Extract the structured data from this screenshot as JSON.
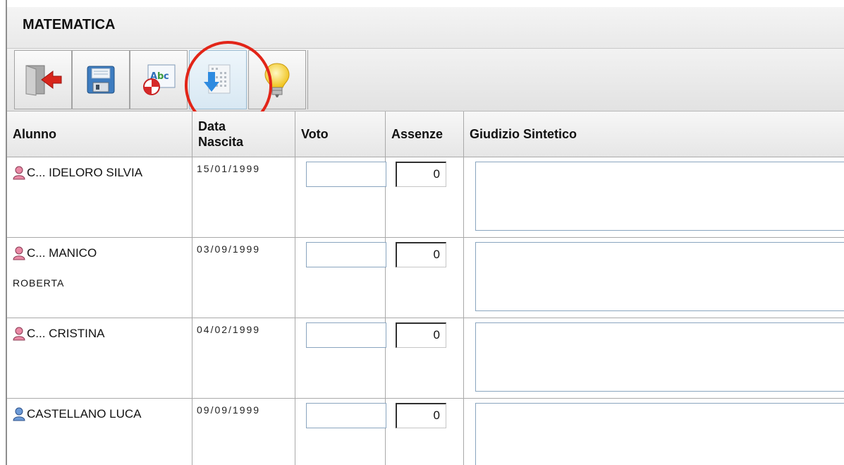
{
  "panel": {
    "title": "MATEMATICA"
  },
  "toolbar": {
    "buttons": [
      {
        "icon": "exit-door-icon",
        "label": ""
      },
      {
        "icon": "floppy-save-icon",
        "label": ""
      },
      {
        "icon": "spellcheck-icon",
        "label": "Abc"
      },
      {
        "icon": "import-down-arrow-icon",
        "label": ""
      },
      {
        "icon": "lightbulb-icon",
        "label": ""
      }
    ]
  },
  "table": {
    "headers": {
      "alunno": "Alunno",
      "data_line1": "Data",
      "data_line2": "Nascita",
      "voto": "Voto",
      "assenze": "Assenze",
      "giudizio": "Giudizio Sintetico"
    },
    "rows": [
      {
        "name": "C... IDELORO SILVIA",
        "name2": "",
        "date": "15/01/1999",
        "voto": "",
        "assenze": "0",
        "giudizio": "",
        "avatar_color": "#e98aa6"
      },
      {
        "name": "C... MANICO",
        "name2": "ROBERTA",
        "date": "03/09/1999",
        "voto": "",
        "assenze": "0",
        "giudizio": "",
        "avatar_color": "#e98aa6"
      },
      {
        "name": "C... CRISTINA",
        "name2": "",
        "date": "04/02/1999",
        "voto": "",
        "assenze": "0",
        "giudizio": "",
        "avatar_color": "#e98aa6"
      },
      {
        "name": "CASTELLANO LUCA",
        "name2": "",
        "date": "09/09/1999",
        "voto": "",
        "assenze": "0",
        "giudizio": "",
        "avatar_color": "#6d9bd8"
      }
    ]
  },
  "colors": {
    "highlight": "#e22518",
    "field_border": "#8aa5bf"
  }
}
